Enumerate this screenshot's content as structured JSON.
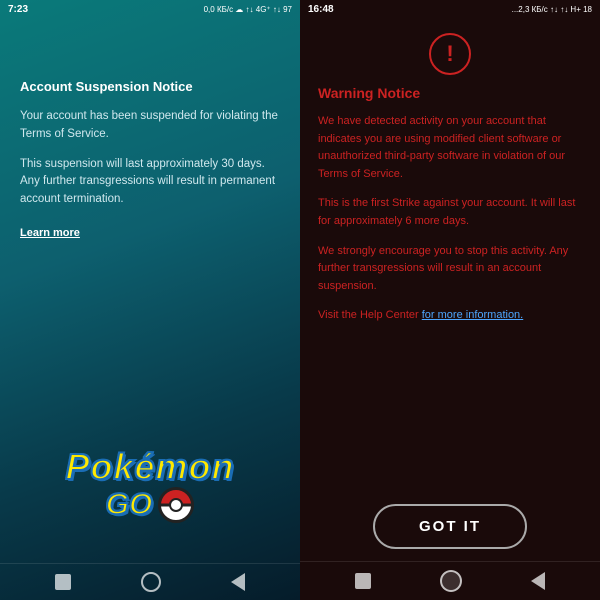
{
  "left": {
    "status_bar": {
      "time": "7:23",
      "info": "0,0 КБ/с ☁ ↑↓ 4G⁺ ↑↓ 97"
    },
    "title": "Account Suspension Notice",
    "body1": "Your account has been suspended for violating the Terms of Service.",
    "body2": "This suspension will last approximately 30 days. Any further transgressions will result in permanent account termination.",
    "learn_more": "Learn more",
    "pokemon_text": "Pokémon",
    "go_text": "GO",
    "nav": {
      "square": "square-nav-icon",
      "circle": "circle-nav-icon",
      "triangle": "triangle-nav-icon"
    }
  },
  "right": {
    "status_bar": {
      "time": "16:48",
      "info": "...2,3 КБ/с ↑↓ ↑↓ H+ 18"
    },
    "warning_icon": "!",
    "warning_title": "Warning Notice",
    "body1": "We have detected activity on your account that indicates you are using modified client software or unauthorized third-party software in violation of our  Terms of Service.",
    "body2": "This is the first Strike against your account. It will last for approximately 6 more days.",
    "body3": "We strongly encourage you to stop this activity. Any further transgressions will result in an account suspension.",
    "body4_prefix": "Visit the Help Center ",
    "body4_link": "for more information.",
    "got_it_label": "GOT IT",
    "nav": {
      "square": "square-nav-icon",
      "circle": "circle-nav-icon",
      "triangle": "triangle-nav-icon"
    }
  }
}
